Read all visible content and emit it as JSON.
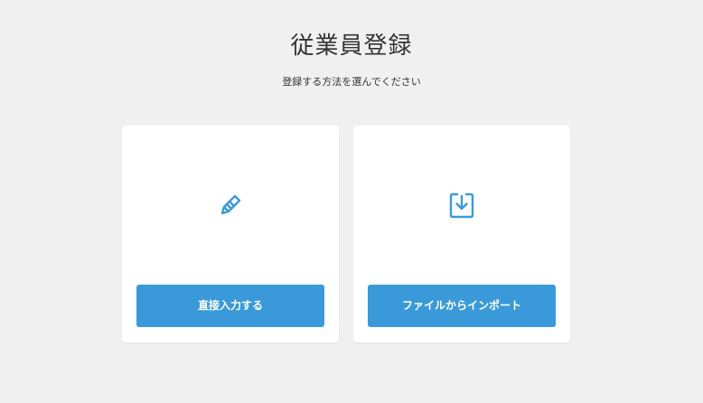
{
  "header": {
    "title": "従業員登録",
    "subtitle": "登録する方法を選んでください"
  },
  "options": [
    {
      "icon": "pencil-icon",
      "button_label": "直接入力する"
    },
    {
      "icon": "import-tray-icon",
      "button_label": "ファイルからインポート"
    }
  ],
  "colors": {
    "background": "#f0f0f0",
    "card": "#ffffff",
    "accent": "#3a9ad9",
    "text": "#333333"
  }
}
